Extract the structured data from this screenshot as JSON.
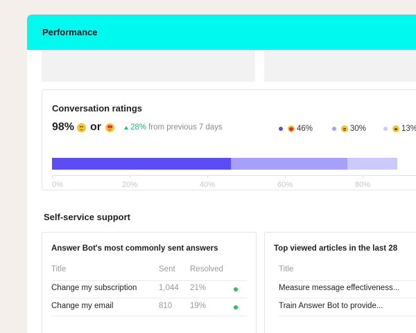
{
  "header": {
    "title": "Performance"
  },
  "ratings": {
    "title": "Conversation ratings",
    "headline_pct": "98%",
    "or_text": "or",
    "trend_value": "28%",
    "trend_suffix": "from previous 7 days",
    "legend": [
      {
        "emoji": "heart-eyes-emoji",
        "label": "46%",
        "color": "#5b4df5"
      },
      {
        "emoji": "grin-emoji",
        "label": "30%",
        "color": "#a6a0fb"
      },
      {
        "emoji": "neutral-emoji",
        "label": "13%",
        "color": "#ccc9fd"
      }
    ],
    "axis_ticks": [
      "0%",
      "20%",
      "40%",
      "60%",
      "80%"
    ]
  },
  "chart_data": {
    "type": "bar",
    "orientation": "horizontal-stacked",
    "categories": [
      "Conversation ratings"
    ],
    "series": [
      {
        "name": "46%",
        "values": [
          46
        ]
      },
      {
        "name": "30%",
        "values": [
          30
        ]
      },
      {
        "name": "13%",
        "values": [
          13
        ]
      }
    ],
    "xlim": [
      0,
      100
    ],
    "tick_labels": [
      "0%",
      "20%",
      "40%",
      "60%",
      "80%"
    ]
  },
  "self_service": {
    "title": "Self-service support",
    "answers": {
      "title": "Answer Bot's most commonly sent answers",
      "headers": {
        "title": "Title",
        "sent": "Sent",
        "resolved": "Resolved"
      },
      "rows": [
        {
          "title": "Change my subscription",
          "sent": "1,044",
          "resolved": "21%",
          "status_color": "#22c55e"
        },
        {
          "title": "Change my email",
          "sent": "810",
          "resolved": "19%",
          "status_color": "#22c55e"
        }
      ]
    },
    "articles": {
      "title": "Top viewed articles in the last 28",
      "headers": {
        "title": "Title"
      },
      "rows": [
        {
          "title": "Measure message effectiveness..."
        },
        {
          "title": "Train Answer Bot to provide..."
        }
      ]
    }
  }
}
